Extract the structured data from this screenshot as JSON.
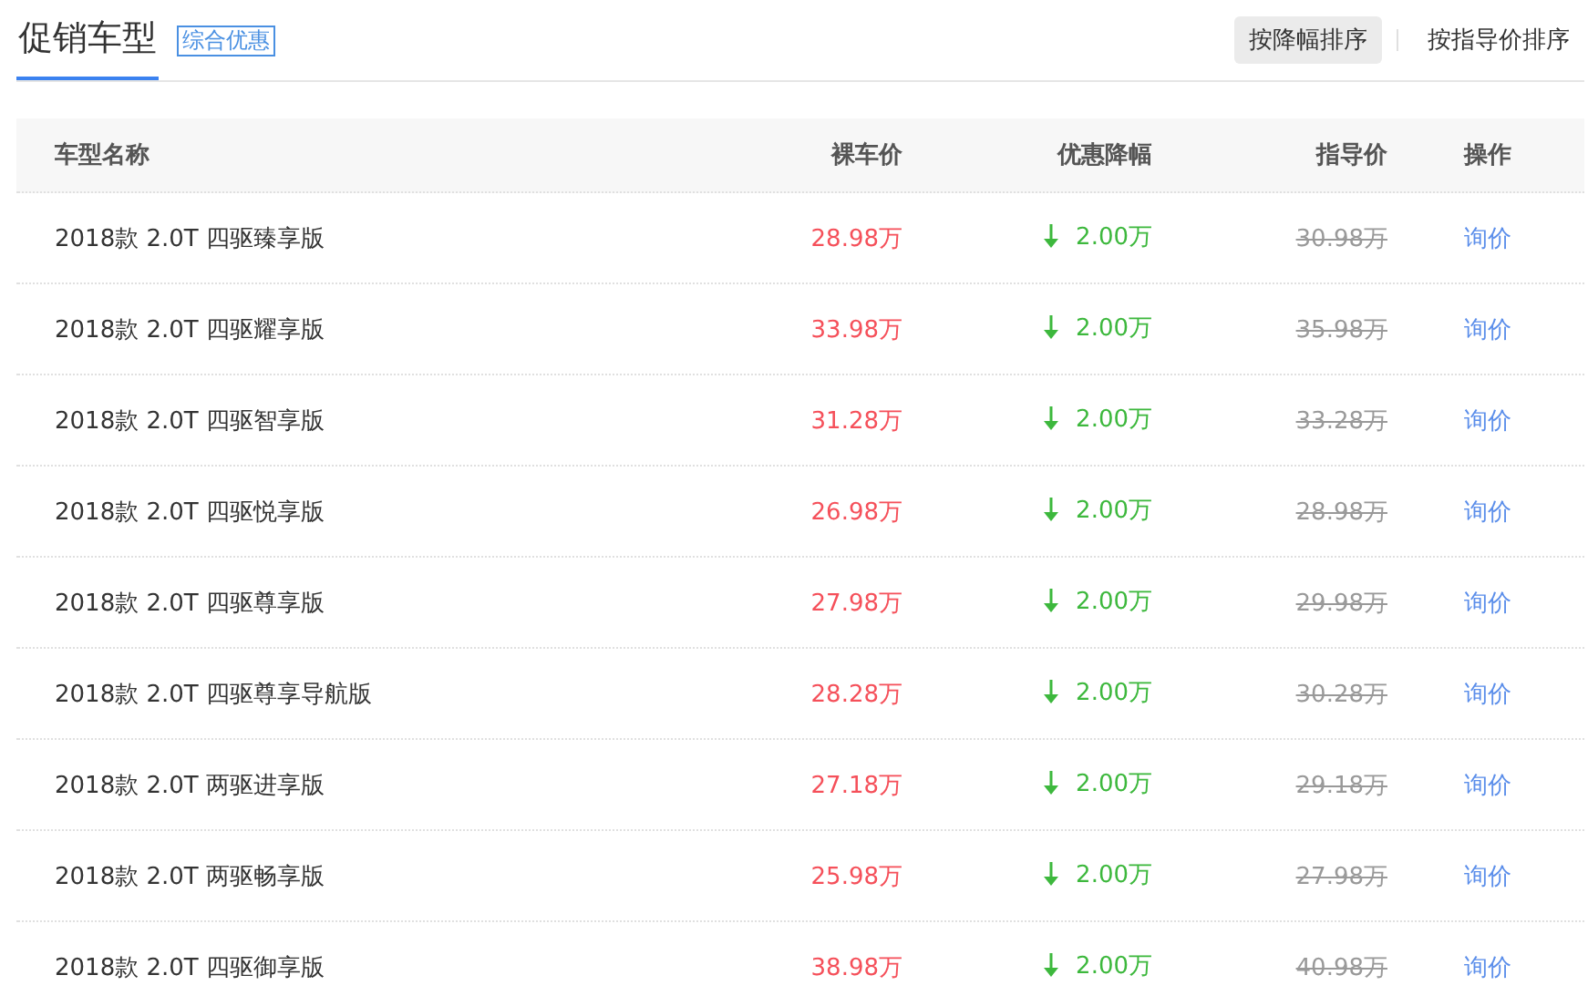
{
  "header": {
    "title": "促销车型",
    "selected": true,
    "tag": "综合优惠"
  },
  "sort_buttons": [
    {
      "label": "按降幅排序",
      "selected": true
    },
    {
      "label": "按指导价排序",
      "selected": false
    }
  ],
  "table": {
    "columns": [
      "车型名称",
      "裸车价",
      "优惠降幅",
      "指导价",
      "操作"
    ],
    "rows": [
      {
        "name": "2018款 2.0T 四驱臻享版",
        "price": "28.98万",
        "discount": "2.00万",
        "guide_price": "30.98万",
        "action": "询价"
      },
      {
        "name": "2018款 2.0T 四驱耀享版",
        "price": "33.98万",
        "discount": "2.00万",
        "guide_price": "35.98万",
        "action": "询价"
      },
      {
        "name": "2018款 2.0T 四驱智享版",
        "price": "31.28万",
        "discount": "2.00万",
        "guide_price": "33.28万",
        "action": "询价"
      },
      {
        "name": "2018款 2.0T 四驱悦享版",
        "price": "26.98万",
        "discount": "2.00万",
        "guide_price": "28.98万",
        "action": "询价"
      },
      {
        "name": "2018款 2.0T 四驱尊享版",
        "price": "27.98万",
        "discount": "2.00万",
        "guide_price": "29.98万",
        "action": "询价"
      },
      {
        "name": "2018款 2.0T 四驱尊享导航版",
        "price": "28.28万",
        "discount": "2.00万",
        "guide_price": "30.28万",
        "action": "询价"
      },
      {
        "name": "2018款 2.0T 两驱进享版",
        "price": "27.18万",
        "discount": "2.00万",
        "guide_price": "29.18万",
        "action": "询价"
      },
      {
        "name": "2018款 2.0T 两驱畅享版",
        "price": "25.98万",
        "discount": "2.00万",
        "guide_price": "27.98万",
        "action": "询价"
      },
      {
        "name": "2018款 2.0T 四驱御享版",
        "price": "38.98万",
        "discount": "2.00万",
        "guide_price": "40.98万",
        "action": "询价"
      }
    ]
  }
}
